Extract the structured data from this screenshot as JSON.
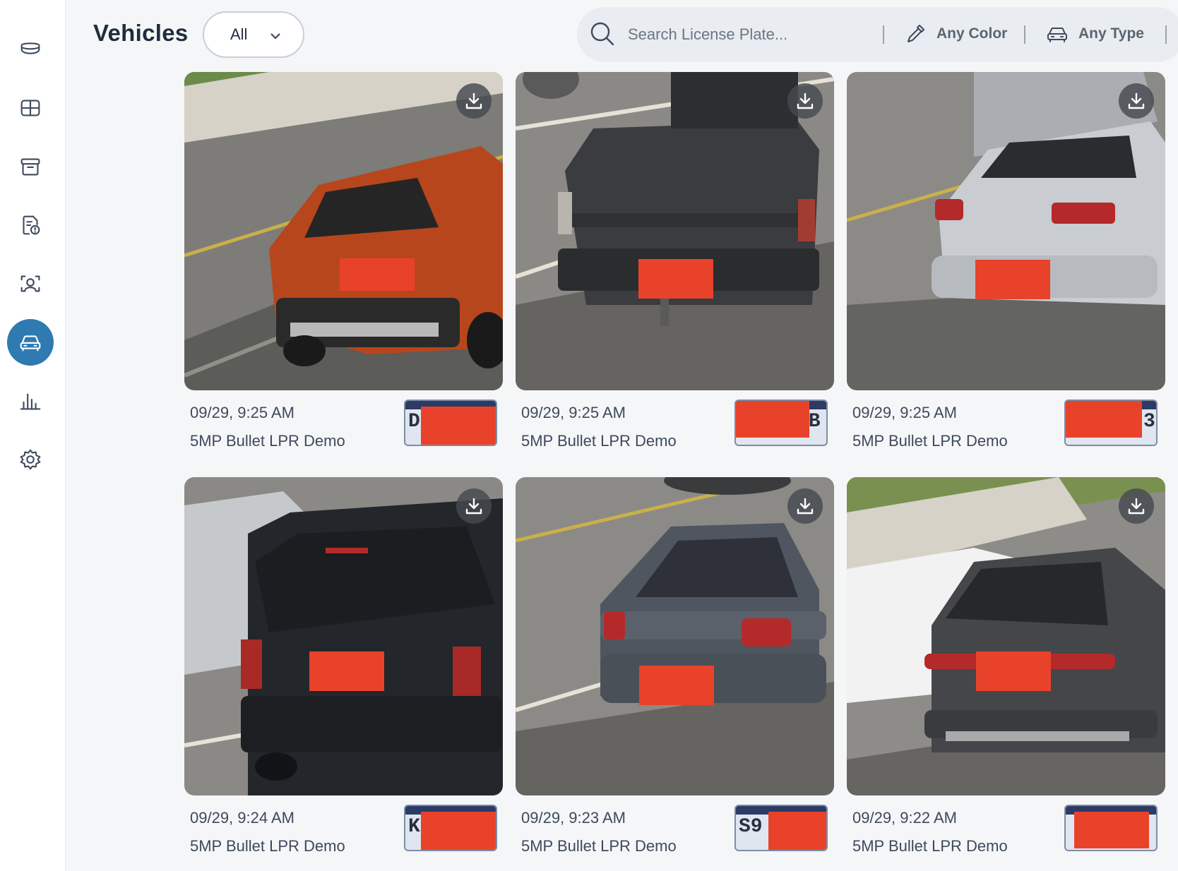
{
  "header": {
    "title": "Vehicles",
    "filter_value": "All"
  },
  "toolbar": {
    "search_placeholder": "Search License Plate...",
    "color_filter": "Any Color",
    "type_filter": "Any Type"
  },
  "sidebar": {
    "items": [
      {
        "icon": "camera-dome-icon",
        "active": false
      },
      {
        "icon": "grid-view-icon",
        "active": false
      },
      {
        "icon": "archive-icon",
        "active": false
      },
      {
        "icon": "report-file-icon",
        "active": false
      },
      {
        "icon": "face-scan-icon",
        "active": false
      },
      {
        "icon": "vehicle-icon",
        "active": true
      },
      {
        "icon": "analytics-icon",
        "active": false
      },
      {
        "icon": "settings-gear-icon",
        "active": false
      }
    ]
  },
  "vehicles": [
    {
      "time": "09/29, 9:25 AM",
      "camera": "5MP Bullet LPR Demo",
      "plate_visible": "D",
      "car_color": "#b8461c"
    },
    {
      "time": "09/29, 9:25 AM",
      "camera": "5MP Bullet LPR Demo",
      "plate_visible": "2B",
      "car_color": "#3a3c40"
    },
    {
      "time": "09/29, 9:25 AM",
      "camera": "5MP Bullet LPR Demo",
      "plate_visible": "3",
      "car_color": "#c9ccd1"
    },
    {
      "time": "09/29, 9:24 AM",
      "camera": "5MP Bullet LPR Demo",
      "plate_visible": "K",
      "car_color": "#23262b"
    },
    {
      "time": "09/29, 9:23 AM",
      "camera": "5MP Bullet LPR Demo",
      "plate_visible": "S9",
      "car_color": "#4f565f"
    },
    {
      "time": "09/29, 9:22 AM",
      "camera": "5MP Bullet LPR Demo",
      "plate_visible": "",
      "car_color": "#45464a"
    }
  ]
}
